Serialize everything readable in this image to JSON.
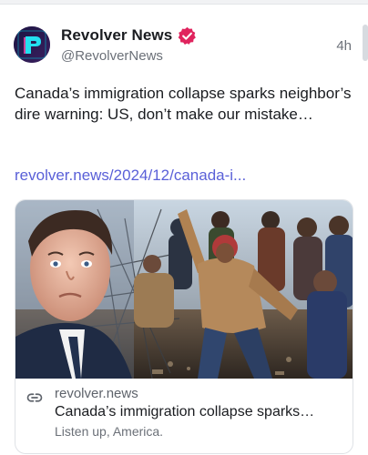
{
  "post": {
    "author_name": "Revolver News",
    "handle": "@RevolverNews",
    "timestamp": "4h",
    "text": "Canada’s immigration collapse sparks neighbor’s dire warning: US, don’t make our mistake…",
    "link_text": "revolver.news/2024/12/canada-i..."
  },
  "link_preview": {
    "domain": "revolver.news",
    "title": "Canada’s immigration collapse sparks…",
    "description": "Listen up, America."
  },
  "icons": {
    "verified": "verified-badge-icon",
    "link": "chain-link-icon"
  },
  "colors": {
    "link": "#5a60d8",
    "verified_badge": "#e0245e",
    "avatar_bg": "#2b1c4f"
  }
}
